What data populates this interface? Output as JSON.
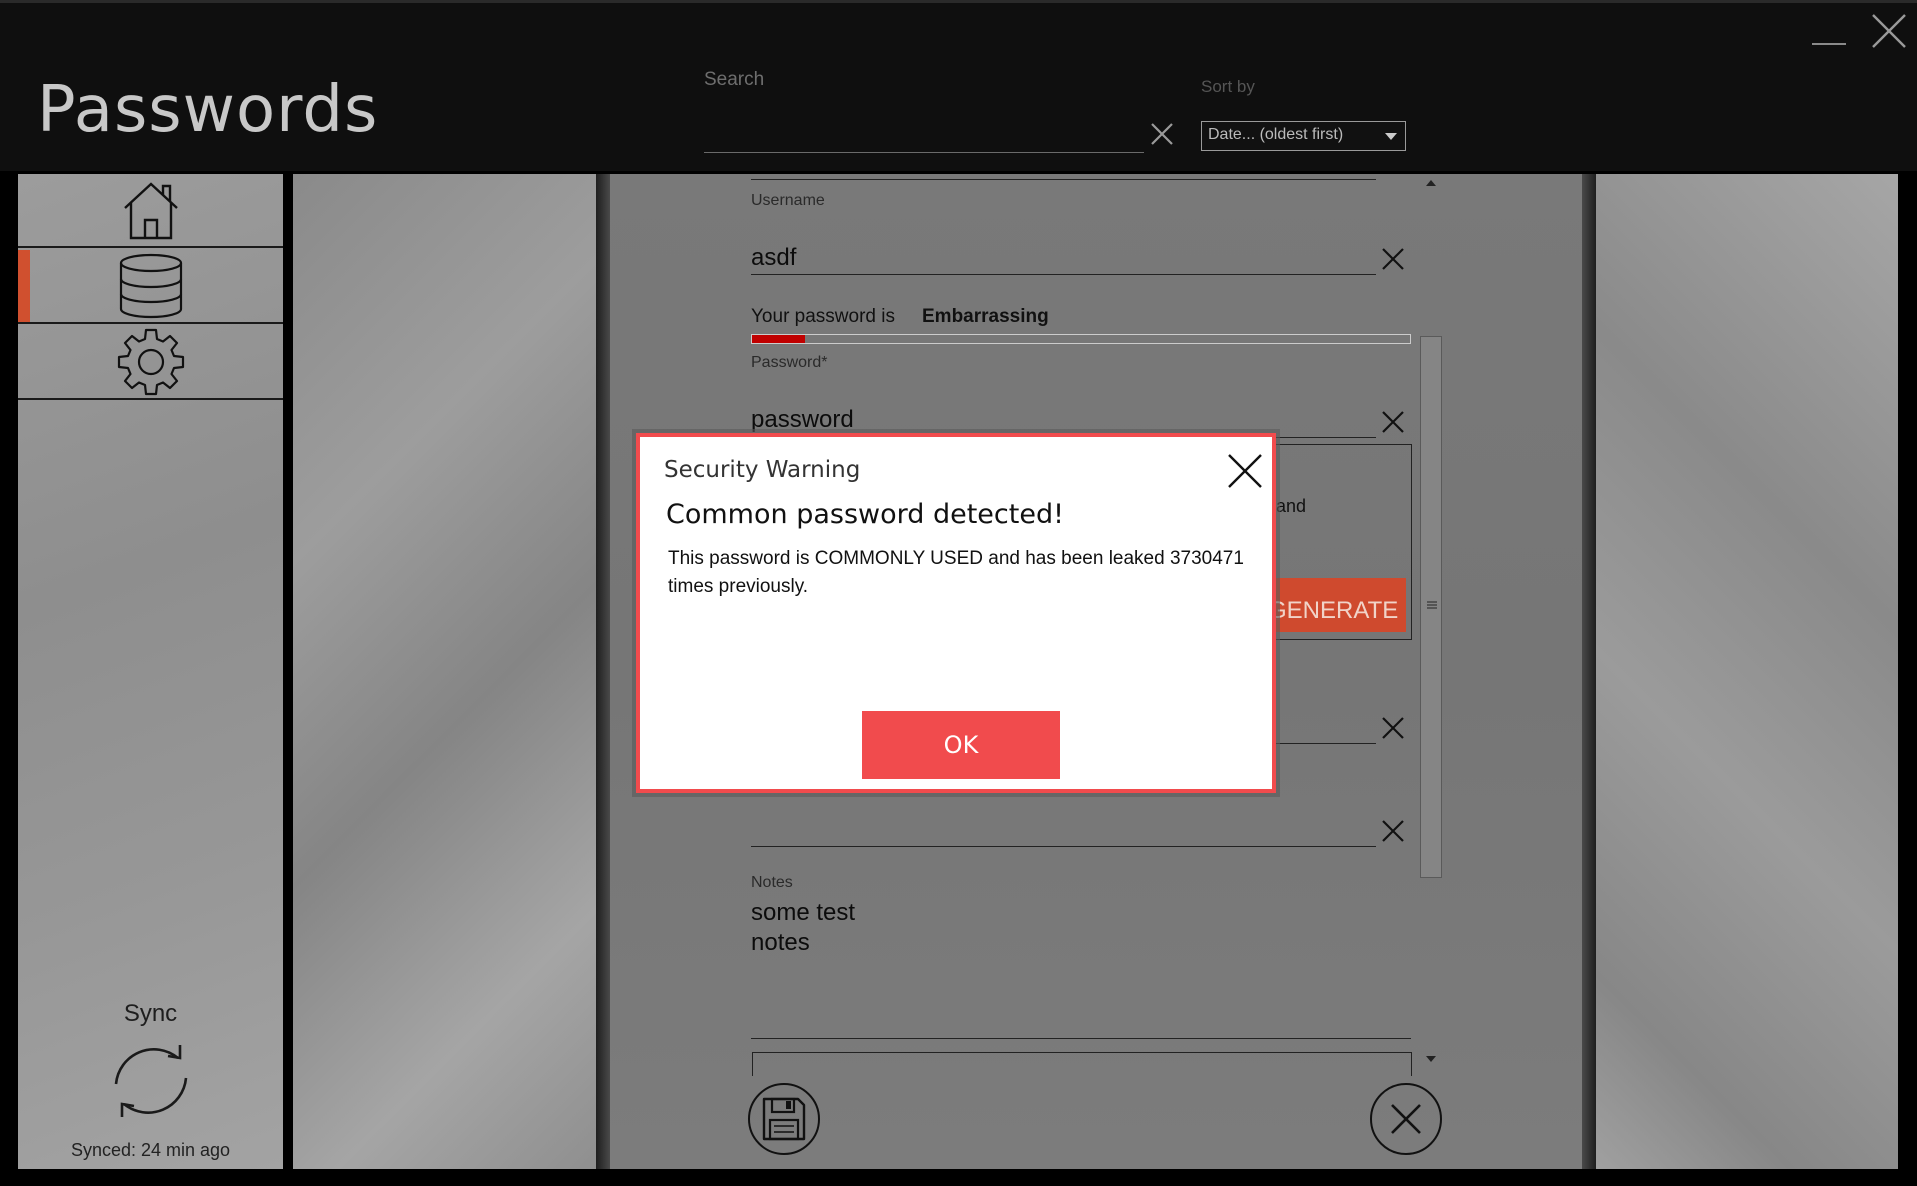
{
  "app": {
    "title": "Passwords"
  },
  "search": {
    "label": "Search",
    "value": "",
    "placeholder": ""
  },
  "sort": {
    "label": "Sort by",
    "selected": "Date... (oldest first)"
  },
  "sidebar": {
    "items": [
      {
        "name": "home",
        "icon": "home-icon"
      },
      {
        "name": "database",
        "icon": "database-icon",
        "active": true
      },
      {
        "name": "settings",
        "icon": "gear-icon"
      }
    ],
    "sync_label": "Sync",
    "sync_status": "Synced: 24 min ago"
  },
  "form": {
    "username_label": "Username",
    "username_value": "asdf",
    "strength_prefix": "Your password is",
    "strength_value": "Embarrassing",
    "strength_level": 0.08,
    "password_label": "Password*",
    "password_value": "password",
    "generator_partial_text": "and",
    "generate_label": "GENERATE",
    "notes_label": "Notes",
    "notes_value_line1": "some test",
    "notes_value_line2": "notes"
  },
  "dialog": {
    "heading": "Security Warning",
    "title": "Common password detected!",
    "message": "This password is COMMONLY USED and has been leaked 3730471 times previously.",
    "ok_label": "OK"
  },
  "colors": {
    "accent": "#d0502f",
    "dialog_accent": "#f14b4d",
    "strength_bad": "#c00000"
  }
}
